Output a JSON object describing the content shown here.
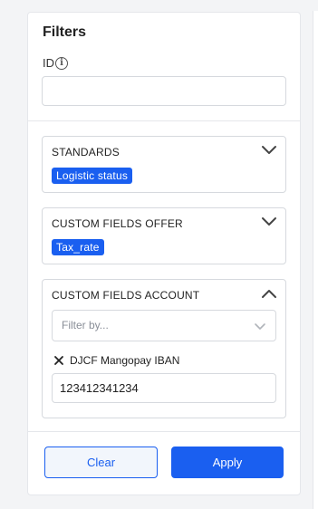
{
  "filters": {
    "title": "Filters",
    "id_label": "ID",
    "id_value": "",
    "sections": {
      "standards": {
        "title": "STANDARDS",
        "chip": "Logistic status",
        "expanded": false
      },
      "offer": {
        "title": "CUSTOM FIELDS OFFER",
        "chip": "Tax_rate",
        "expanded": false
      },
      "account": {
        "title": "CUSTOM FIELDS ACCOUNT",
        "expanded": true,
        "filter_placeholder": "Filter by...",
        "field_label": "DJCF Mangopay IBAN",
        "field_value": "123412341234"
      }
    },
    "buttons": {
      "clear": "Clear",
      "apply": "Apply"
    }
  },
  "colors": {
    "accent": "#1a5ff0",
    "border": "#d6d9de",
    "background": "#f3f4f6"
  },
  "icons": {
    "info": "info-circle-icon",
    "chevron_down": "chevron-down-icon",
    "chevron_up": "chevron-up-icon",
    "close": "close-icon"
  }
}
